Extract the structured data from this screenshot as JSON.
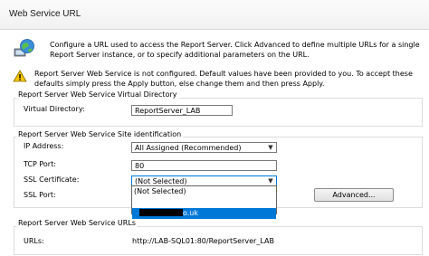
{
  "header": {
    "title": "Web Service URL"
  },
  "intro": {
    "text": "Configure a URL used to access the Report Server.  Click Advanced to define multiple URLs for a single Report Server instance, or to specify additional parameters on the URL.",
    "icon": "globe-network-icon"
  },
  "warning": {
    "text": "Report Server Web Service is not configured. Default values have been provided to you. To accept these defaults simply press the Apply button, else change them and then press Apply.",
    "icon": "warning-icon",
    "color": "#f5c400"
  },
  "virtual_directory": {
    "group_title": "Report Server Web Service Virtual Directory",
    "label": "Virtual Directory:",
    "value": "ReportServer_LAB"
  },
  "site_identification": {
    "group_title": "Report Server Web Service Site identification",
    "ip_label": "IP Address:",
    "ip_value": "All Assigned (Recommended)",
    "tcp_label": "TCP Port:",
    "tcp_value": "80",
    "ssl_cert_label": "SSL Certificate:",
    "ssl_cert_value": "(Not Selected)",
    "ssl_port_label": "SSL Port:",
    "advanced_label": "Advanced...",
    "dropdown_options": [
      "(Not Selected)",
      "",
      "o.uk"
    ]
  },
  "urls": {
    "group_title": "Report Server Web Service URLs",
    "label": "URLs:",
    "value": "http://LAB-SQL01:80/ReportServer_LAB"
  },
  "colors": {
    "accent": "#0078d7"
  }
}
